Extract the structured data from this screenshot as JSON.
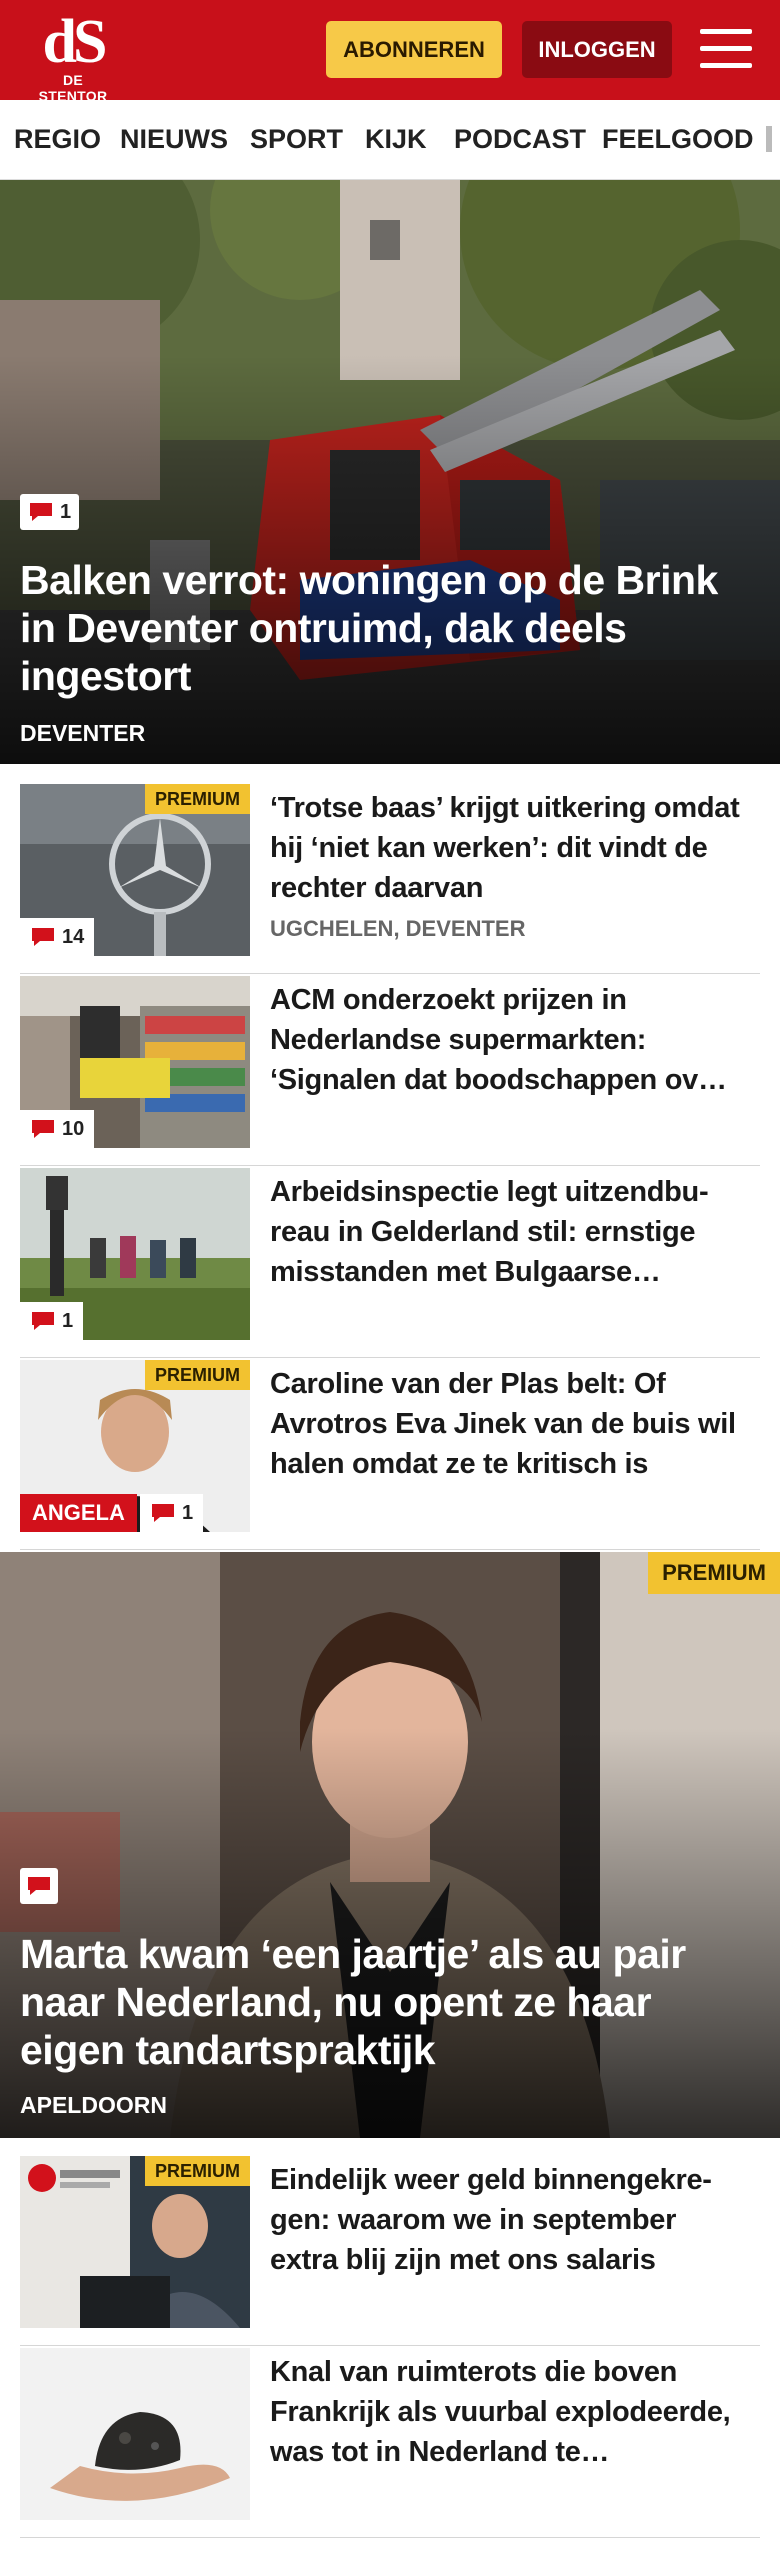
{
  "header": {
    "logo_mark": "dS",
    "logo_text": "DE STENTOR",
    "subscribe_label": "ABONNEREN",
    "login_label": "INLOGGEN",
    "brand_color": "#c8101a"
  },
  "nav": {
    "items": [
      "REGIO",
      "NIEUWS",
      "SPORT",
      "KIJK",
      "PODCAST",
      "FEELGOOD"
    ]
  },
  "hero1": {
    "comments": "1",
    "title": "Balken verrot: woningen op de Brink in Deventer ontruimd, dak deels ingestort",
    "location": "DEVENTER"
  },
  "articles": [
    {
      "premium": "PREMIUM",
      "comments": "14",
      "title": "‘Trotse baas’ krijgt uitkering omdat hij ‘niet kan werken’: dit vindt de rechter daarvan",
      "location": "UGCHELEN, DEVENTER"
    },
    {
      "comments": "10",
      "title": "ACM onderzoekt prijzen in Nederlandse supermarkten: ‘Signalen dat boodschappen ov…"
    },
    {
      "comments": "1",
      "title": "Arbeidsinspectie legt uitzendbu­reau in Gelderland stil: ernstige misstanden met Bulgaarse…"
    },
    {
      "premium": "PREMIUM",
      "label": "ANGELA",
      "comments": "1",
      "title": "Caroline van der Plas belt: Of Avrotros Eva Jinek van de buis wil halen omdat ze te kritisch is"
    }
  ],
  "hero2": {
    "premium": "PREMIUM",
    "title": "Marta kwam ‘een jaartje’ als au pair naar Nederland, nu opent ze haar eigen tandartspraktijk",
    "location": "APELDOORN"
  },
  "articles2": [
    {
      "premium": "PREMIUM",
      "title": "Eindelijk weer geld binnengekre­gen: waarom we in september extra blij zijn met ons salaris"
    },
    {
      "title": "Knal van ruimterots die boven Frankrijk als vuurbal explodeer­de, was tot in Nederland te…"
    }
  ]
}
